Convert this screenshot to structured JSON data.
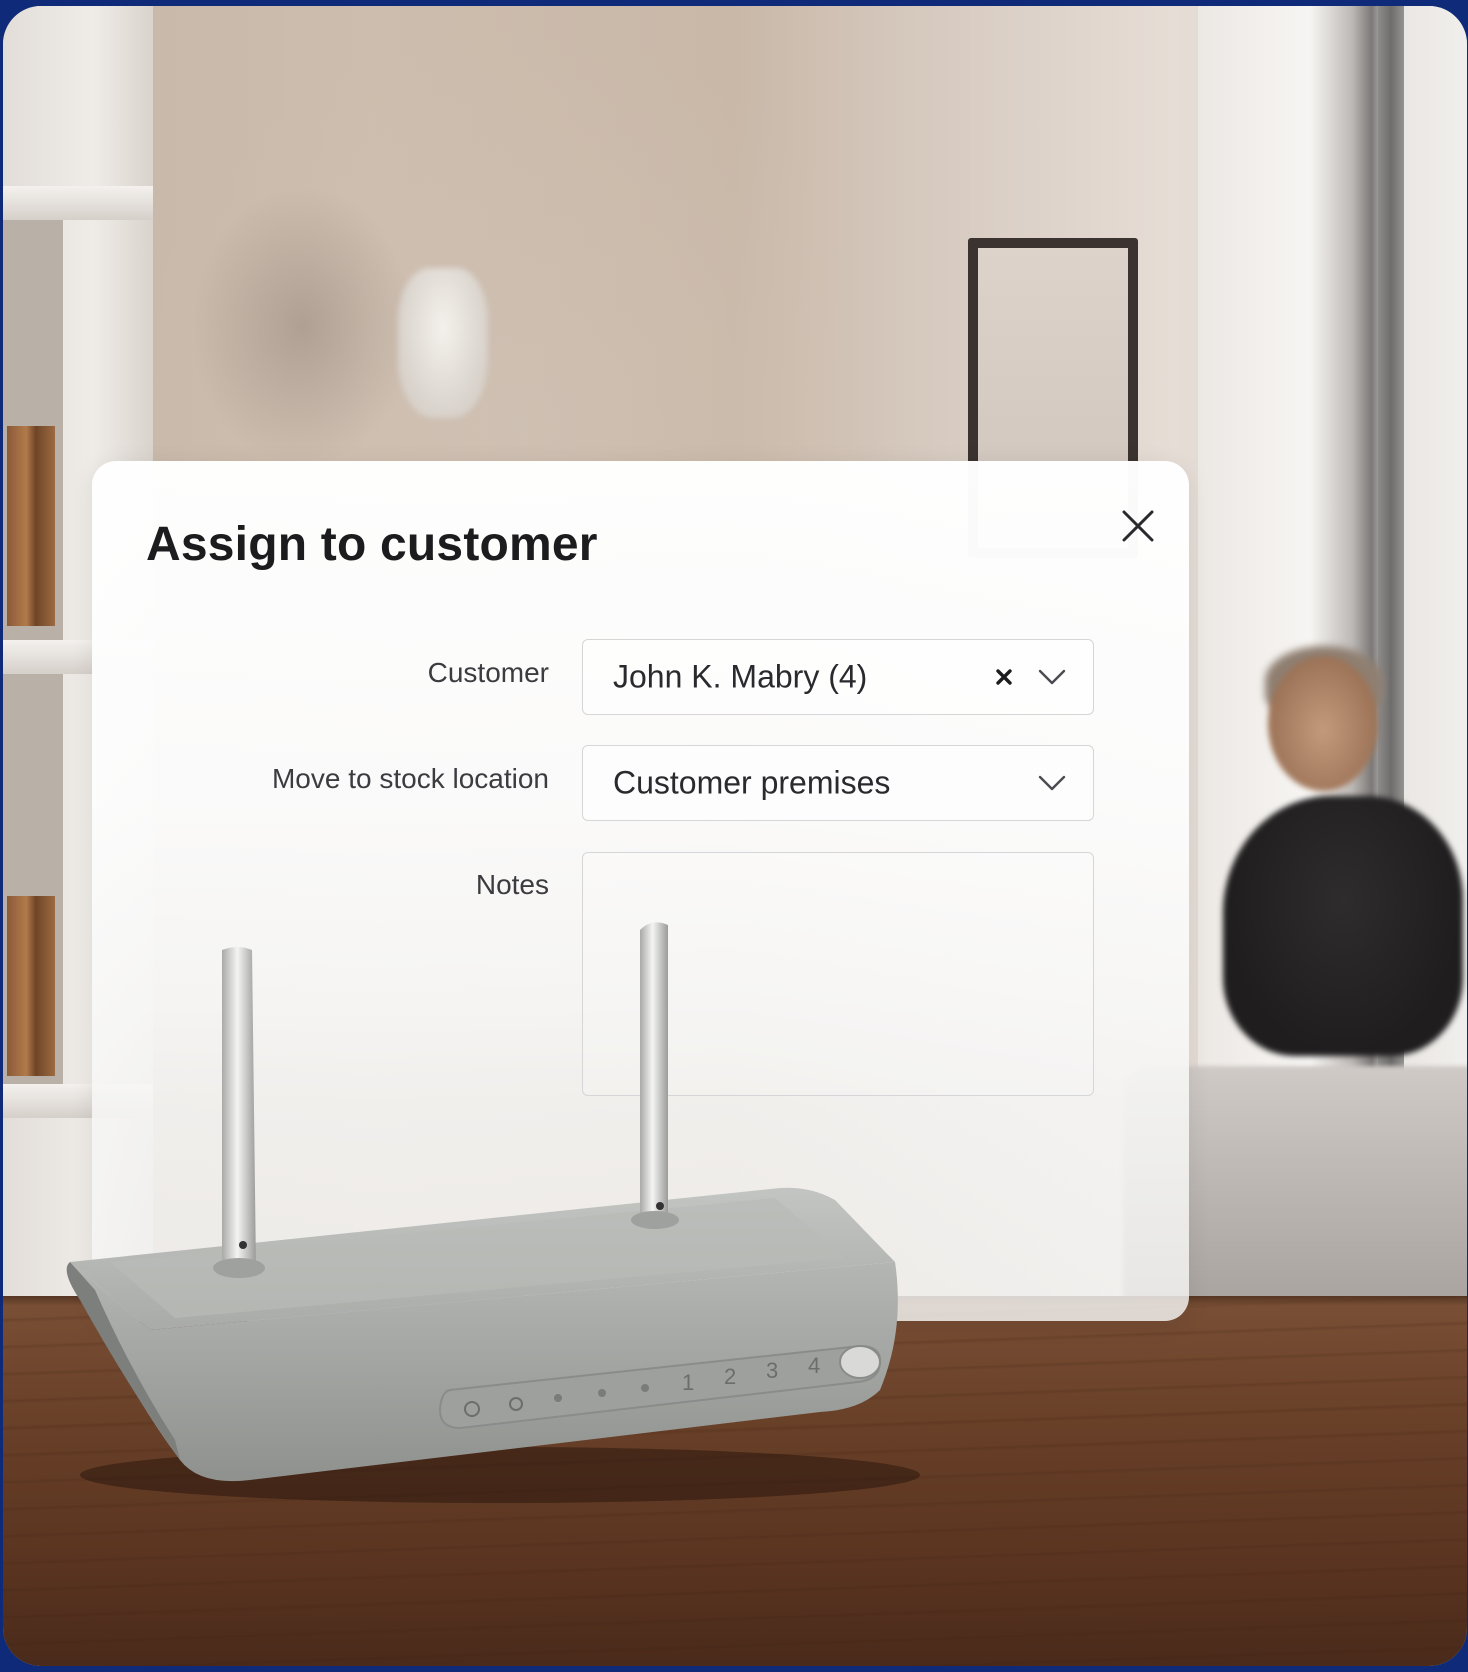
{
  "dialog": {
    "title": "Assign to customer",
    "close_icon": "close-icon"
  },
  "form": {
    "customer": {
      "label": "Customer",
      "value": "John K. Mabry (4)",
      "clear_icon": "clear-icon",
      "dropdown_icon": "chevron-down-icon"
    },
    "stock_location": {
      "label": "Move to stock location",
      "value": "Customer premises",
      "dropdown_icon": "chevron-down-icon"
    },
    "notes": {
      "label": "Notes",
      "value": ""
    }
  },
  "router_panel": {
    "port_labels": [
      "1",
      "2",
      "3",
      "4"
    ]
  }
}
